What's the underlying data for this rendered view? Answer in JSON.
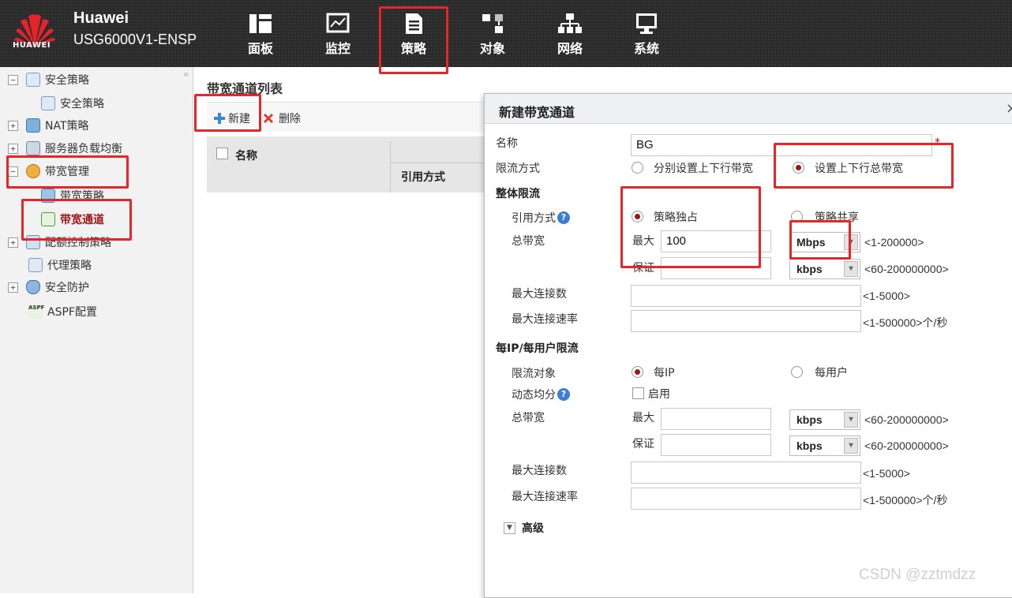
{
  "header": {
    "brand": "Huawei",
    "logo_text": "HUAWEI",
    "model": "USG6000V1-ENSP",
    "nav": [
      {
        "label": "面板",
        "icon": "dashboard-icon"
      },
      {
        "label": "监控",
        "icon": "monitor-icon"
      },
      {
        "label": "策略",
        "icon": "policy-icon"
      },
      {
        "label": "对象",
        "icon": "object-icon"
      },
      {
        "label": "网络",
        "icon": "network-icon"
      },
      {
        "label": "系统",
        "icon": "system-icon"
      }
    ]
  },
  "sidebar": {
    "items": [
      {
        "label": "安全策略",
        "expander": "−"
      },
      {
        "label": "安全策略"
      },
      {
        "label": "NAT策略",
        "expander": "+"
      },
      {
        "label": "服务器负载均衡",
        "expander": "+"
      },
      {
        "label": "带宽管理",
        "expander": "−"
      },
      {
        "label": "带宽策略"
      },
      {
        "label": "带宽通道"
      },
      {
        "label": "配额控制策略",
        "expander": "+"
      },
      {
        "label": "代理策略"
      },
      {
        "label": "安全防护",
        "expander": "+"
      },
      {
        "label": "ASPF配置"
      }
    ],
    "aspf_icon_text": "ASPF"
  },
  "list": {
    "title": "带宽通道列表",
    "new_label": "新建",
    "delete_label": "删除",
    "columns": [
      "名称",
      "引用方式"
    ]
  },
  "dialog": {
    "title": "新建带宽通道",
    "close": "×",
    "name_label": "名称",
    "name_value": "BG",
    "required_mark": "*",
    "limit_mode_label": "限流方式",
    "limit_mode_options": [
      "分别设置上下行带宽",
      "设置上下行总带宽"
    ],
    "overall_section": "整体限流",
    "ref_mode_label": "引用方式",
    "ref_mode_options": [
      "策略独占",
      "策略共享"
    ],
    "total_bw_label": "总带宽",
    "max_label": "最大",
    "max_value": "100",
    "max_unit": "Mbps",
    "max_hint": "<1-200000>",
    "guarantee_label": "保证",
    "guarantee_unit": "kbps",
    "guarantee_hint": "<60-200000000>",
    "max_conn_label": "最大连接数",
    "max_conn_hint": "<1-5000>",
    "max_rate_label": "最大连接速率",
    "max_rate_hint": "<1-500000>个/秒",
    "per_section": "每IP/每用户限流",
    "target_label": "限流对象",
    "target_options": [
      "每IP",
      "每用户"
    ],
    "dynamic_label": "动态均分",
    "enable_label": "启用",
    "per_total_label": "总带宽",
    "per_max_label": "最大",
    "per_max_unit": "kbps",
    "per_max_hint": "<60-200000000>",
    "per_guarantee_label": "保证",
    "per_guarantee_unit": "kbps",
    "per_guarantee_hint": "<60-200000000>",
    "per_conn_label": "最大连接数",
    "per_conn_hint": "<1-5000>",
    "per_rate_label": "最大连接速率",
    "per_rate_hint": "<1-500000>个/秒",
    "advanced_label": "高级"
  },
  "watermark": "CSDN @zztmdzz",
  "colors": {
    "highlight": "#e8262a",
    "topbar": "#2b2b2b",
    "active": "#a01515"
  }
}
